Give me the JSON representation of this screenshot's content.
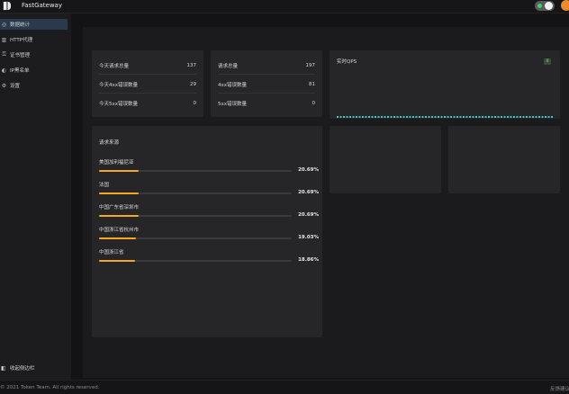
{
  "app": {
    "title": "FastGateway"
  },
  "header": {
    "toggle_on": true,
    "accent": "#3bd16f",
    "avatar_color": "#f08a24"
  },
  "sidebar": {
    "items": [
      {
        "label": "数据统计",
        "icon": "dashboard-icon",
        "active": true
      },
      {
        "label": "HTTP代理",
        "icon": "bar-chart-icon",
        "active": false
      },
      {
        "label": "证书管理",
        "icon": "key-icon",
        "active": false
      },
      {
        "label": "IP黑名单",
        "icon": "shield-icon",
        "active": false
      },
      {
        "label": "设置",
        "icon": "gear-icon",
        "active": false
      }
    ],
    "collapse_label": "收起侧边栏",
    "collapse_icon": "collapse-icon"
  },
  "stats_left": {
    "rows": [
      {
        "label": "今天请求总量",
        "value": "137"
      },
      {
        "label": "今天4xx错误数量",
        "value": "29"
      },
      {
        "label": "今天5xx错误数量",
        "value": "0"
      }
    ]
  },
  "stats_right": {
    "rows": [
      {
        "label": "请求总量",
        "value": "197"
      },
      {
        "label": "4xx错误数量",
        "value": "81"
      },
      {
        "label": "5xx错误数量",
        "value": "0"
      }
    ]
  },
  "qps": {
    "title": "实时QPS",
    "badge": "0",
    "line_color": "#3fc7c0"
  },
  "sources": {
    "title": "请求来源",
    "bar_color": "#f5a623",
    "items": [
      {
        "label": "美国加利福尼亚",
        "percent": "20.69%",
        "fraction": 0.2069
      },
      {
        "label": "法国",
        "percent": "20.69%",
        "fraction": 0.2069
      },
      {
        "label": "中国广东省深圳市",
        "percent": "20.69%",
        "fraction": 0.2069
      },
      {
        "label": "中国浙江省杭州市",
        "percent": "19.03%",
        "fraction": 0.1903
      },
      {
        "label": "中国浙江省",
        "percent": "18.86%",
        "fraction": 0.1886
      }
    ]
  },
  "footer": {
    "copyright": "© 2021 Token Team. All rights reserved.",
    "feedback": "反馈建议"
  }
}
